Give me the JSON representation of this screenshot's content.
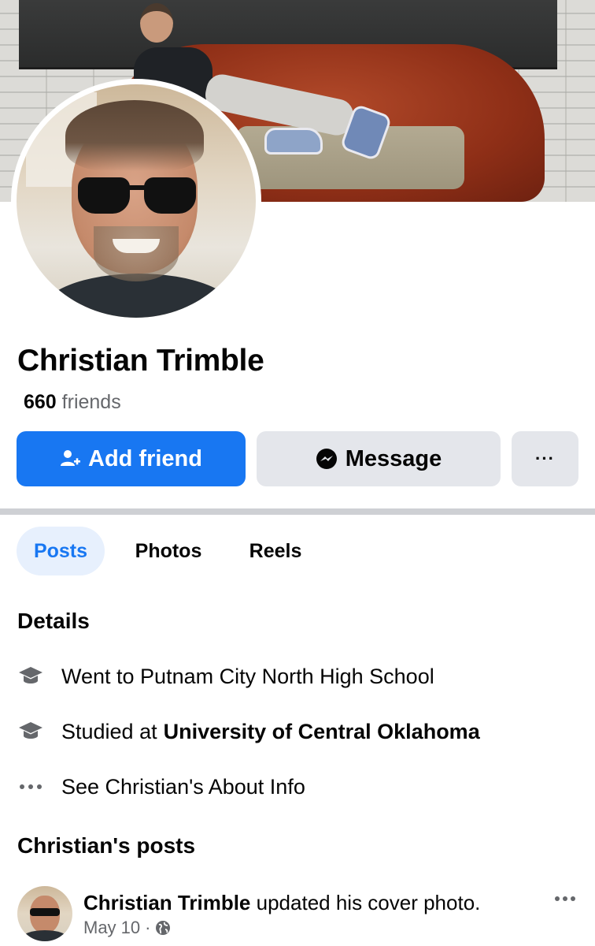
{
  "profile": {
    "name": "Christian Trimble",
    "friends_count": "660",
    "friends_label": "friends"
  },
  "actions": {
    "add_friend": "Add friend",
    "message": "Message",
    "more": "···"
  },
  "tabs": [
    {
      "label": "Posts",
      "active": true
    },
    {
      "label": "Photos",
      "active": false
    },
    {
      "label": "Reels",
      "active": false
    }
  ],
  "details": {
    "title": "Details",
    "items": [
      {
        "icon": "graduation-cap-icon",
        "text": "Went to Putnam City North High School"
      },
      {
        "icon": "graduation-cap-icon",
        "prefix": "Studied at",
        "bold": "University of Central Oklahoma"
      },
      {
        "icon": "more-dots-icon",
        "text": "See Christian's About Info"
      }
    ]
  },
  "posts": {
    "title": "Christian's posts",
    "first": {
      "author": "Christian Trimble",
      "action": "updated his cover photo.",
      "date": "May 10",
      "separator": "·",
      "audience_icon": "globe-icon"
    }
  },
  "colors": {
    "primary": "#1877f2",
    "secondary_button": "#e4e6eb",
    "muted_text": "#65676b",
    "active_tab_bg": "#e7f0fd"
  }
}
